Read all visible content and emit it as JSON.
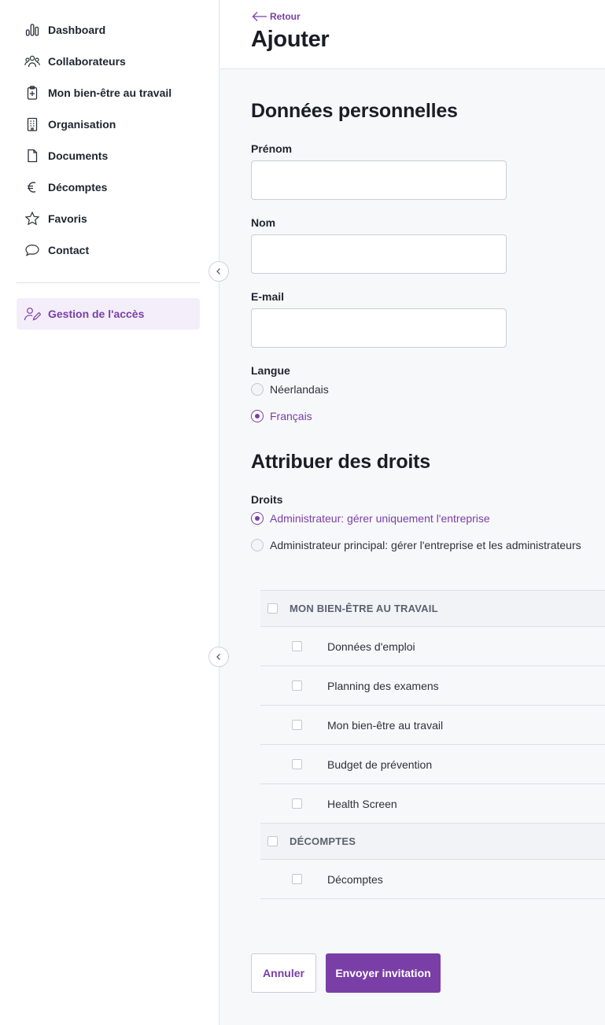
{
  "sidebar": {
    "items": [
      {
        "label": "Dashboard",
        "icon": "bar-chart-icon"
      },
      {
        "label": "Collaborateurs",
        "icon": "users-icon"
      },
      {
        "label": "Mon bien-être au travail",
        "icon": "medical-clipboard-icon"
      },
      {
        "label": "Organisation",
        "icon": "building-icon"
      },
      {
        "label": "Documents",
        "icon": "document-icon"
      },
      {
        "label": "Décomptes",
        "icon": "euro-icon"
      },
      {
        "label": "Favoris",
        "icon": "star-icon"
      },
      {
        "label": "Contact",
        "icon": "chat-bubble-icon"
      }
    ],
    "active_item": {
      "label": "Gestion de l'accès",
      "icon": "user-edit-icon"
    }
  },
  "header": {
    "back_label": "Retour",
    "title": "Ajouter"
  },
  "personal": {
    "section_title": "Données personnelles",
    "first_name_label": "Prénom",
    "first_name_value": "",
    "last_name_label": "Nom",
    "last_name_value": "",
    "email_label": "E-mail",
    "email_value": "",
    "language_label": "Langue",
    "language_options": [
      "Néerlandais",
      "Français"
    ],
    "language_selected": "Français"
  },
  "rights": {
    "section_title": "Attribuer des droits",
    "label": "Droits",
    "options": [
      "Administrateur: gérer uniquement l'entreprise",
      "Administrateur principal: gérer l'entreprise et les administrateurs"
    ],
    "selected": "Administrateur: gérer uniquement l'entreprise",
    "table": {
      "groups": [
        {
          "name": "MON BIEN-ÊTRE AU TRAVAIL",
          "items": [
            "Données d'emploi",
            "Planning des examens",
            "Mon bien-être au travail",
            "Budget de prévention",
            "Health Screen"
          ]
        },
        {
          "name": "DÉCOMPTES",
          "items": [
            "Décomptes"
          ]
        }
      ]
    }
  },
  "actions": {
    "cancel_label": "Annuler",
    "submit_label": "Envoyer invitation"
  },
  "colors": {
    "accent": "#7a3fa6",
    "active_bg": "#f4eefb"
  }
}
